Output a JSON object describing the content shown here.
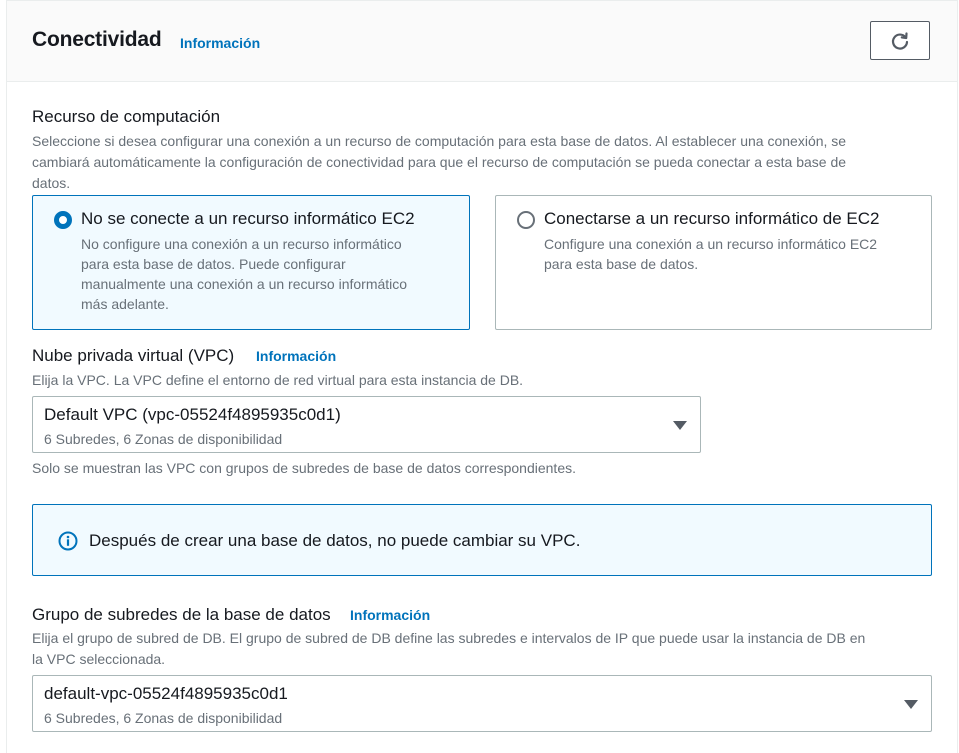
{
  "header": {
    "title": "Conectividad",
    "info_link": "Información",
    "refresh_icon": "refresh-icon"
  },
  "compute": {
    "label": "Recurso de computación",
    "description_line1": "Seleccione si desea configurar una conexión a un recurso de computación para esta base de datos. Al establecer una conexión, se",
    "description_line2": "cambiará automáticamente la configuración de conectividad para que el recurso de computación se pueda conectar a esta base de",
    "description_line3": "datos.",
    "options": [
      {
        "title": "No se conecte a un recurso informático EC2",
        "desc_line1": "No configure una conexión a un recurso informático",
        "desc_line2": "para esta base de datos. Puede configurar",
        "desc_line3": "manualmente una conexión a un recurso informático",
        "desc_line4": "más adelante.",
        "selected": true
      },
      {
        "title": "Conectarse a un recurso informático de EC2",
        "desc_line1": "Configure una conexión a un recurso informático EC2",
        "desc_line2": "para esta base de datos.",
        "selected": false
      }
    ]
  },
  "vpc": {
    "label": "Nube privada virtual (VPC)",
    "info_link": "Información",
    "description": "Elija la VPC. La VPC define el entorno de red virtual para esta instancia de DB.",
    "selected_value": "Default VPC (vpc-05524f4895935c0d1)",
    "selected_sub": "6 Subredes, 6 Zonas de disponibilidad",
    "hint": "Solo se muestran las VPC con grupos de subredes de base de datos correspondientes."
  },
  "alert": {
    "icon": "info-icon",
    "text": "Después de crear una base de datos, no puede cambiar su VPC."
  },
  "subnet_group": {
    "label": "Grupo de subredes de la base de datos",
    "info_link": "Información",
    "description_line1": "Elija el grupo de subred de DB. El grupo de subred de DB define las subredes e intervalos de IP que puede usar la instancia de DB en",
    "description_line2": "la VPC seleccionada.",
    "selected_value": "default-vpc-05524f4895935c0d1",
    "selected_sub": "6 Subredes, 6 Zonas de disponibilidad"
  },
  "colors": {
    "accent": "#0073bb",
    "tile_selected_bg": "#f1faff",
    "text_primary": "#16191f",
    "text_secondary": "#687078"
  }
}
